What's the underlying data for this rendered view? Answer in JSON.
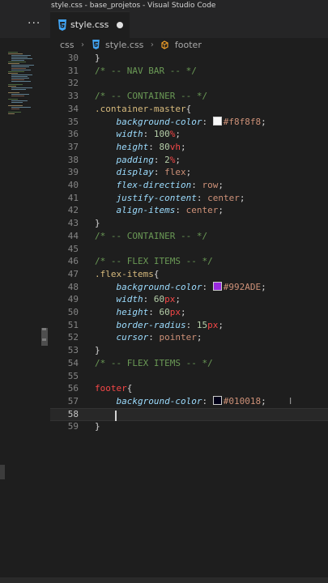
{
  "window": {
    "title": "style.css - base_projetos - Visual Studio Code"
  },
  "tabs": [
    {
      "label": "style.css",
      "modified": true,
      "icon": "css3-icon"
    }
  ],
  "toolbar": {
    "more_label": "···"
  },
  "breadcrumb": {
    "items": [
      {
        "label": "css",
        "icon": null
      },
      {
        "label": "style.css",
        "icon": "css3-icon"
      },
      {
        "label": "footer",
        "icon": "symbol-class-icon"
      }
    ],
    "separator": "›"
  },
  "editor": {
    "current_line": 58,
    "lines": [
      {
        "n": "30",
        "t": [
          [
            "punc",
            "}"
          ]
        ]
      },
      {
        "n": "31",
        "t": [
          [
            "comment",
            "/* -- NAV BAR -- */"
          ]
        ]
      },
      {
        "n": "32",
        "t": []
      },
      {
        "n": "33",
        "t": [
          [
            "comment",
            "/* -- CONTAINER -- */"
          ]
        ]
      },
      {
        "n": "34",
        "t": [
          [
            "sel",
            ".container-master"
          ],
          [
            "punc",
            "{"
          ]
        ]
      },
      {
        "n": "35",
        "t": [
          [
            "pad",
            "    "
          ],
          [
            "prop",
            "background-color"
          ],
          [
            "punc",
            ": "
          ],
          [
            "swatch",
            "#f8f8f8"
          ],
          [
            "hex",
            "#f8f8f8"
          ],
          [
            "punc",
            ";"
          ]
        ]
      },
      {
        "n": "36",
        "t": [
          [
            "pad",
            "    "
          ],
          [
            "prop",
            "width"
          ],
          [
            "punc",
            ": "
          ],
          [
            "num",
            "100"
          ],
          [
            "unit",
            "%"
          ],
          [
            "punc",
            ";"
          ]
        ]
      },
      {
        "n": "37",
        "t": [
          [
            "pad",
            "    "
          ],
          [
            "prop",
            "height"
          ],
          [
            "punc",
            ": "
          ],
          [
            "num",
            "80"
          ],
          [
            "unit",
            "vh"
          ],
          [
            "punc",
            ";"
          ]
        ]
      },
      {
        "n": "38",
        "t": [
          [
            "pad",
            "    "
          ],
          [
            "prop",
            "padding"
          ],
          [
            "punc",
            ": "
          ],
          [
            "num",
            "2"
          ],
          [
            "unit",
            "%"
          ],
          [
            "punc",
            ";"
          ]
        ]
      },
      {
        "n": "39",
        "t": [
          [
            "pad",
            "    "
          ],
          [
            "prop",
            "display"
          ],
          [
            "punc",
            ": "
          ],
          [
            "val",
            "flex"
          ],
          [
            "punc",
            ";"
          ]
        ]
      },
      {
        "n": "40",
        "t": [
          [
            "pad",
            "    "
          ],
          [
            "prop",
            "flex-direction"
          ],
          [
            "punc",
            ": "
          ],
          [
            "val",
            "row"
          ],
          [
            "punc",
            ";"
          ]
        ]
      },
      {
        "n": "41",
        "t": [
          [
            "pad",
            "    "
          ],
          [
            "prop",
            "justify-content"
          ],
          [
            "punc",
            ": "
          ],
          [
            "val",
            "center"
          ],
          [
            "punc",
            ";"
          ]
        ]
      },
      {
        "n": "42",
        "t": [
          [
            "pad",
            "    "
          ],
          [
            "prop",
            "align-items"
          ],
          [
            "punc",
            ": "
          ],
          [
            "val",
            "center"
          ],
          [
            "punc",
            ";"
          ]
        ]
      },
      {
        "n": "43",
        "t": [
          [
            "punc",
            "}"
          ]
        ]
      },
      {
        "n": "44",
        "t": [
          [
            "comment",
            "/* -- CONTAINER -- */"
          ]
        ]
      },
      {
        "n": "45",
        "t": []
      },
      {
        "n": "46",
        "t": [
          [
            "comment",
            "/* -- FLEX ITEMS -- */"
          ]
        ]
      },
      {
        "n": "47",
        "t": [
          [
            "sel",
            ".flex-items"
          ],
          [
            "punc",
            "{"
          ]
        ]
      },
      {
        "n": "48",
        "t": [
          [
            "pad",
            "    "
          ],
          [
            "prop",
            "background-color"
          ],
          [
            "punc",
            ": "
          ],
          [
            "swatch",
            "#992ADE"
          ],
          [
            "hex",
            "#992ADE"
          ],
          [
            "punc",
            ";"
          ]
        ]
      },
      {
        "n": "49",
        "t": [
          [
            "pad",
            "    "
          ],
          [
            "prop",
            "width"
          ],
          [
            "punc",
            ": "
          ],
          [
            "num",
            "60"
          ],
          [
            "unit",
            "px"
          ],
          [
            "punc",
            ";"
          ]
        ]
      },
      {
        "n": "50",
        "t": [
          [
            "pad",
            "    "
          ],
          [
            "prop",
            "height"
          ],
          [
            "punc",
            ": "
          ],
          [
            "num",
            "60"
          ],
          [
            "unit",
            "px"
          ],
          [
            "punc",
            ";"
          ]
        ]
      },
      {
        "n": "51",
        "t": [
          [
            "pad",
            "    "
          ],
          [
            "prop",
            "border-radius"
          ],
          [
            "punc",
            ": "
          ],
          [
            "num",
            "15"
          ],
          [
            "unit",
            "px"
          ],
          [
            "punc",
            ";"
          ]
        ]
      },
      {
        "n": "52",
        "t": [
          [
            "pad",
            "    "
          ],
          [
            "prop",
            "cursor"
          ],
          [
            "punc",
            ": "
          ],
          [
            "val",
            "pointer"
          ],
          [
            "punc",
            ";"
          ]
        ]
      },
      {
        "n": "53",
        "t": [
          [
            "punc",
            "}"
          ]
        ]
      },
      {
        "n": "54",
        "t": [
          [
            "comment",
            "/* -- FLEX ITEMS -- */"
          ]
        ]
      },
      {
        "n": "55",
        "t": []
      },
      {
        "n": "56",
        "t": [
          [
            "unit",
            "footer"
          ],
          [
            "punc",
            "{"
          ]
        ]
      },
      {
        "n": "57",
        "t": [
          [
            "pad",
            "    "
          ],
          [
            "prop",
            "background-color"
          ],
          [
            "punc",
            ": "
          ],
          [
            "swatch",
            "#010018"
          ],
          [
            "hex",
            "#010018"
          ],
          [
            "punc",
            ";"
          ]
        ]
      },
      {
        "n": "58",
        "t": []
      },
      {
        "n": "59",
        "t": [
          [
            "punc",
            "}"
          ]
        ]
      }
    ]
  },
  "colors": {
    "background": "#1e1e1e",
    "comment": "#6a9955",
    "selector": "#d7ba7d",
    "property": "#9cdcfe",
    "number": "#b5cea8",
    "unit": "#f44747",
    "value": "#ce9178"
  }
}
